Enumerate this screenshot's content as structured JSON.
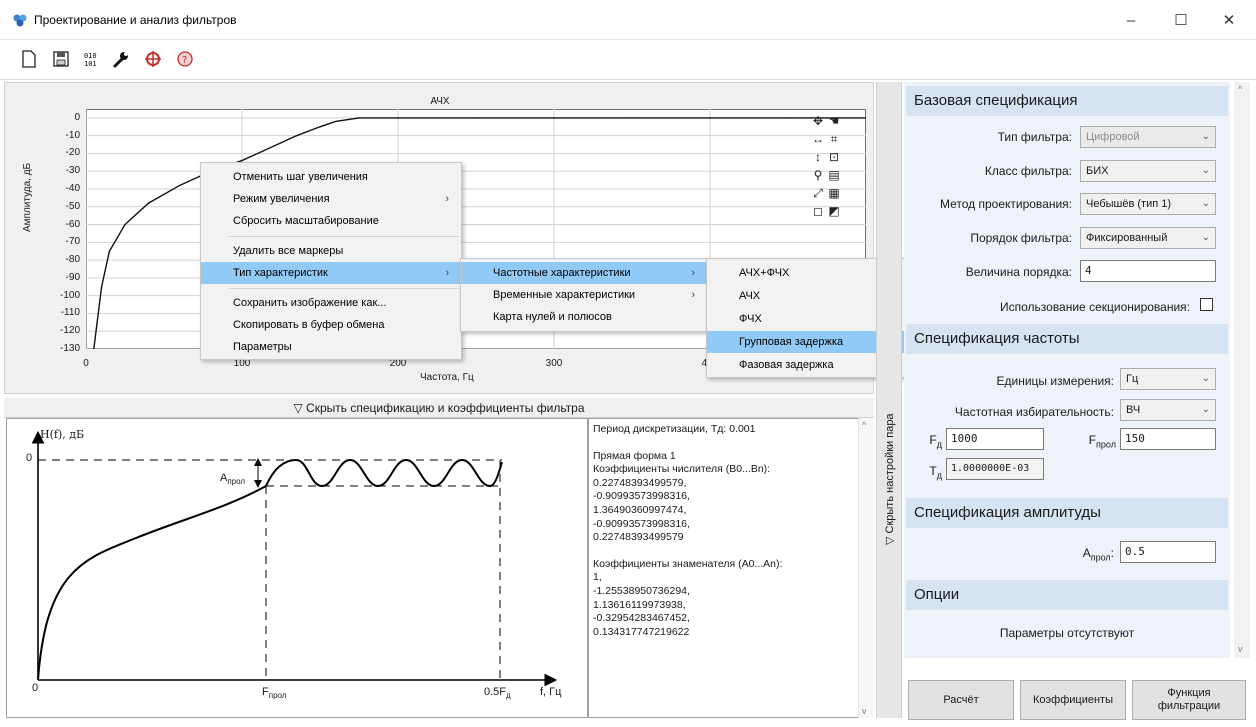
{
  "window": {
    "title": "Проектирование и анализ фильтров",
    "minimize": "–",
    "maximize": "☐",
    "close": "✕"
  },
  "toolbar": {
    "icons": [
      "new-file-icon",
      "save-icon",
      "binary-icon",
      "wrench-icon",
      "target-icon",
      "help-icon"
    ]
  },
  "plot": {
    "title": "АЧХ",
    "ylabel": "Амплитуда, дБ",
    "xlabel": "Частота, Гц",
    "yticks": [
      "0",
      "-10",
      "-20",
      "-30",
      "-40",
      "-50",
      "-60",
      "-70",
      "-80",
      "-90",
      "-100",
      "-110",
      "-120",
      "-130"
    ],
    "xticks": [
      "0",
      "100",
      "200",
      "300",
      "400"
    ],
    "chart_data": {
      "type": "line",
      "title": "АЧХ",
      "xlabel": "Частота, Гц",
      "ylabel": "Амплитуда, дБ",
      "xlim": [
        0,
        500
      ],
      "ylim": [
        -130,
        5
      ],
      "grid": true,
      "x": [
        5,
        10,
        15,
        25,
        40,
        60,
        80,
        100,
        120,
        135,
        150,
        160,
        175,
        200,
        250,
        300,
        350,
        400,
        450,
        500
      ],
      "y": [
        -130,
        -95,
        -75,
        -60,
        -48,
        -38,
        -30,
        -24,
        -16,
        -10,
        -5,
        -2,
        0,
        0,
        0,
        0,
        0,
        0,
        0,
        0
      ]
    }
  },
  "context_menu": {
    "items": [
      {
        "label": "Отменить шаг увеличения"
      },
      {
        "label": "Режим увеличения",
        "arrow": "›"
      },
      {
        "label": "Сбросить масштабирование"
      },
      {
        "label": "Удалить все маркеры"
      },
      {
        "label": "Тип характеристик",
        "arrow": "›"
      },
      {
        "label": "Сохранить изображение как..."
      },
      {
        "label": "Скопировать в буфер обмена"
      },
      {
        "label": "Параметры"
      }
    ],
    "sub1": [
      {
        "label": "Частотные характеристики",
        "arrow": "›"
      },
      {
        "label": "Временные характеристики",
        "arrow": "›"
      },
      {
        "label": "Карта нулей и полюсов"
      }
    ],
    "sub2": [
      {
        "label": "АЧХ+ФЧХ"
      },
      {
        "label": "АЧХ"
      },
      {
        "label": "ФЧХ"
      },
      {
        "label": "Групповая задержка"
      },
      {
        "label": "Фазовая задержка"
      }
    ]
  },
  "spec_toggle": "▽ Скрыть спецификацию и коэффициенты фильтра",
  "schematic": {
    "h_label": "H(f), дБ",
    "zero": "0",
    "a_label": "A",
    "a_sub": "прол",
    "origin": "0",
    "fpass": "F",
    "fpass_sub": "прол",
    "half_fd": "0.5F",
    "half_fd_sub": "д",
    "f_label": "f, Гц"
  },
  "coefficients": {
    "period": "Период дискретизации, Тд: 0.001",
    "form": "Прямая форма 1",
    "num_header": "Коэффициенты числителя (B0...Bn):",
    "num": [
      "0.22748393499579,",
      "-0.90993573998316,",
      "1.36490360997474,",
      "-0.90993573998316,",
      "0.22748393499579"
    ],
    "den_header": "Коэффициенты знаменателя (A0...An):",
    "den": [
      "1,",
      "-1.25538950736294,",
      "1.13616119973938,",
      "-0.32954283467452,",
      "0.134317747219622"
    ]
  },
  "vtab_label": "▽ Скрыть настройки пара",
  "right": {
    "base_header": "Базовая спецификация",
    "filter_type_label": "Тип фильтра:",
    "filter_type_value": "Цифровой",
    "filter_class_label": "Класс фильтра:",
    "filter_class_value": "БИХ",
    "method_label": "Метод проектирования:",
    "method_value": "Чебышёв (тип 1)",
    "order_label": "Порядок фильтра:",
    "order_value": "Фиксированный",
    "order_size_label": "Величина порядка:",
    "order_size_value": "4",
    "sections_label": "Использование секционирования:",
    "freq_header": "Спецификация частоты",
    "units_label": "Единицы измерения:",
    "units_value": "Гц",
    "selectivity_label": "Частотная избирательность:",
    "selectivity_value": "ВЧ",
    "fd_label": "F",
    "fd_sub": "д",
    "fd_value": "1000",
    "fpass_label": "F",
    "fpass_sub": "прол",
    "fpass_value": "150",
    "td_label": "T",
    "td_sub": "д",
    "td_value": "1.0000000E-03",
    "amp_header": "Спецификация амплитуды",
    "apass_label": "A",
    "apass_sub": "прол",
    "apass_value": "0.5",
    "options_header": "Опции",
    "options_text": "Параметры отсутствуют"
  },
  "buttons": {
    "calc": "Расчёт",
    "coef": "Коэффициенты",
    "func1": "Функция",
    "func2": "фильтрации"
  }
}
